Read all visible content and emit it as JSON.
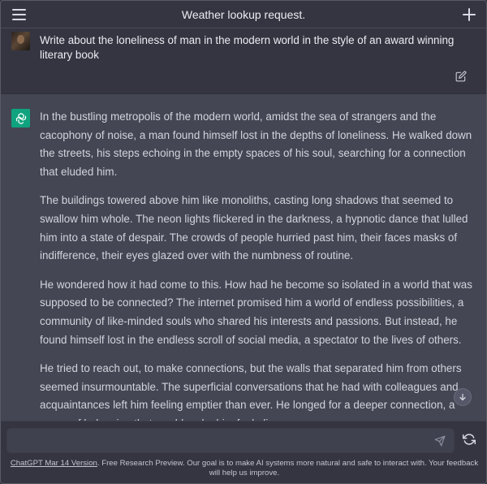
{
  "header": {
    "title": "Weather lookup request."
  },
  "user_message": {
    "text": "Write about the loneliness of man in the modern world in the style of an award winning literary book"
  },
  "assistant_message": {
    "paragraphs": [
      "In the bustling metropolis of the modern world, amidst the sea of strangers and the cacophony of noise, a man found himself lost in the depths of loneliness. He walked down the streets, his steps echoing in the empty spaces of his soul, searching for a connection that eluded him.",
      "The buildings towered above him like monoliths, casting long shadows that seemed to swallow him whole. The neon lights flickered in the darkness, a hypnotic dance that lulled him into a state of despair. The crowds of people hurried past him, their faces masks of indifference, their eyes glazed over with the numbness of routine.",
      "He wondered how it had come to this. How had he become so isolated in a world that was supposed to be connected? The internet promised him a world of endless possibilities, a community of like-minded souls who shared his interests and passions. But instead, he found himself lost in the endless scroll of social media, a spectator to the lives of others.",
      "He tried to reach out, to make connections, but the walls that separated him from others seemed insurmountable. The superficial conversations that he had with colleagues and acquaintances left him feeling emptier than ever. He longed for a deeper connection, a sense of belonging that would make him feel alive."
    ]
  },
  "composer": {
    "placeholder": "",
    "value": ""
  },
  "footer": {
    "version_link": "ChatGPT Mar 14 Version",
    "text": ". Free Research Preview. Our goal is to make AI systems more natural and safe to interact with. Your feedback will help us improve."
  },
  "icons": {
    "menu": "hamburger-icon",
    "new_chat": "plus-icon",
    "edit": "pencil-icon",
    "assistant": "openai-logo",
    "scroll": "arrow-down-icon",
    "send": "paper-plane-icon",
    "regenerate": "refresh-icon"
  },
  "colors": {
    "background": "#343541",
    "assistant_background": "#444654",
    "input_background": "#40414f",
    "logo_green": "#10a37f"
  }
}
